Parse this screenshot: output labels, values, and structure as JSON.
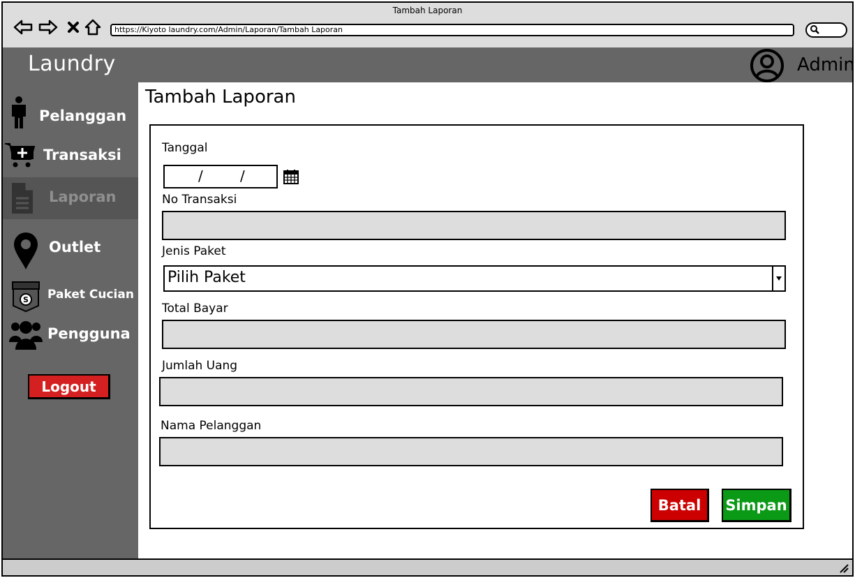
{
  "window": {
    "title": "Tambah Laporan",
    "url": "https://Kiyoto laundry.com/Admin/Laporan/Tambah Laporan"
  },
  "icons": {
    "back": "back-arrow-icon",
    "forward": "forward-arrow-icon",
    "stop": "close-icon",
    "home": "home-icon",
    "search": "search-icon",
    "user": "user-avatar-icon",
    "calendar": "calendar-icon",
    "dropdown": "chevron-down-icon"
  },
  "header": {
    "brand": "Laundry",
    "user_name": "Admin"
  },
  "sidebar": {
    "items": [
      {
        "label": "Pelanggan",
        "icon": "person-icon",
        "active": false
      },
      {
        "label": "Transaksi",
        "icon": "cart-add-icon",
        "active": false
      },
      {
        "label": "Laporan",
        "icon": "document-icon",
        "active": true
      },
      {
        "label": "Outlet",
        "icon": "map-pin-icon",
        "active": false
      },
      {
        "label": "Paket Cucian",
        "icon": "laundry-bag-icon",
        "active": false
      },
      {
        "label": "Pengguna",
        "icon": "users-icon",
        "active": false
      }
    ],
    "logout_label": "Logout"
  },
  "main": {
    "title": "Tambah Laporan",
    "form": {
      "tanggal_label": "Tanggal",
      "tanggal_separator_1": "/",
      "tanggal_separator_2": "/",
      "no_transaksi_label": "No Transaksi",
      "jenis_paket_label": "Jenis Paket",
      "jenis_paket_selected": "Pilih Paket",
      "total_bayar_label": "Total Bayar",
      "jumlah_uang_label": "Jumlah Uang",
      "nama_pelanggan_label": "Nama Pelanggan",
      "cancel_label": "Batal",
      "save_label": "Simpan"
    }
  },
  "colors": {
    "sidebar_bg": "#666666",
    "active_item_bg": "#555555",
    "logout": "#d42020",
    "cancel": "#cc0000",
    "save": "#0a9a16",
    "field_bg": "#dddddd"
  }
}
